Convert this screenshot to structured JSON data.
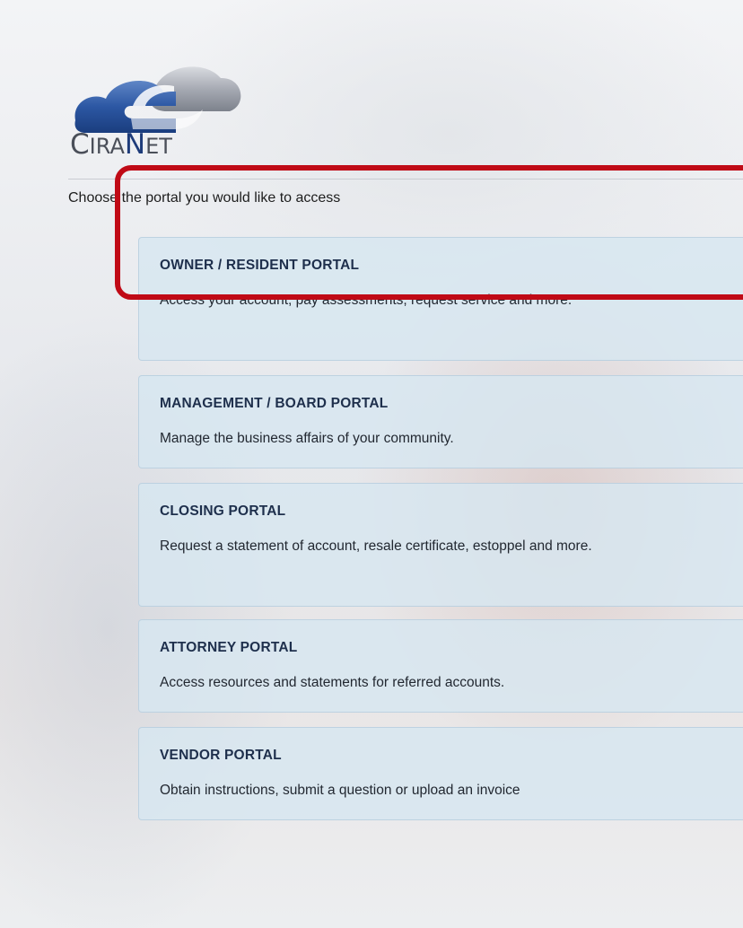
{
  "logo": {
    "text_c": "C",
    "text_ira": "IRA",
    "text_n": "N",
    "text_et": "ET"
  },
  "prompt": "Choose the portal you would like to access",
  "portals": [
    {
      "title": "OWNER / RESIDENT PORTAL",
      "description": "Access your account, pay assessments, request service and more."
    },
    {
      "title": "MANAGEMENT / BOARD PORTAL",
      "description": "Manage the business affairs of your community."
    },
    {
      "title": "CLOSING PORTAL",
      "description": "Request a statement of account, resale certificate, estoppel and more."
    },
    {
      "title": "ATTORNEY PORTAL",
      "description": "Access resources and statements for referred accounts."
    },
    {
      "title": "VENDOR PORTAL",
      "description": "Obtain instructions, submit a question or upload an invoice"
    }
  ],
  "colors": {
    "highlight": "#c00a16",
    "card_title": "#1e2f4c",
    "card_bg": "#d7e6f0"
  },
  "icons": {
    "logo_mark": "cloud-logo-icon"
  }
}
